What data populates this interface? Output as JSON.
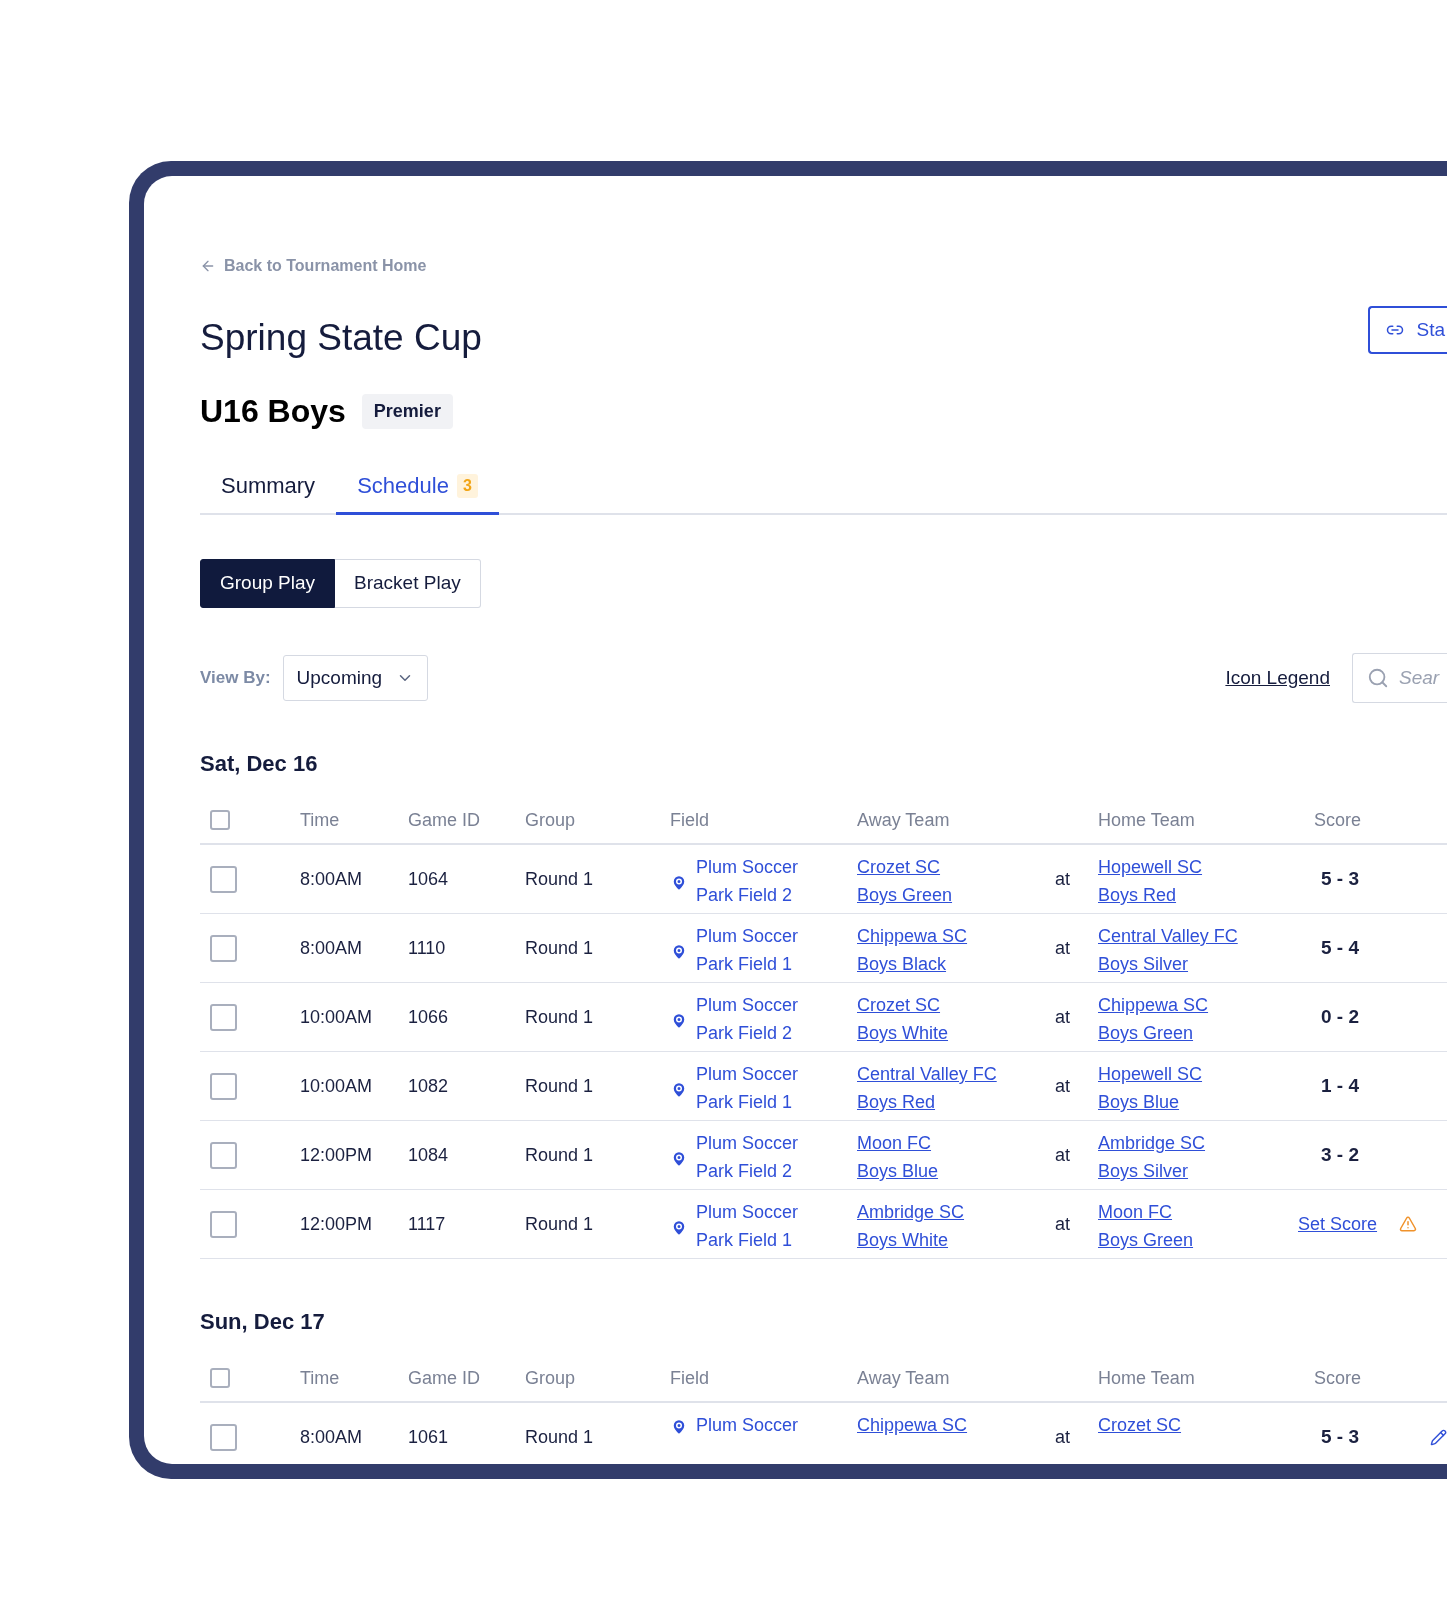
{
  "back_link": "Back to Tournament Home",
  "title": "Spring State Cup",
  "share_button": {
    "label": "Sta"
  },
  "division": {
    "name": "U16 Boys",
    "badge": "Premier"
  },
  "tabs": [
    {
      "label": "Summary",
      "selected": false
    },
    {
      "label": "Schedule",
      "selected": true,
      "badge": "3"
    }
  ],
  "play_toggle": [
    {
      "label": "Group Play",
      "selected": true
    },
    {
      "label": "Bracket Play",
      "selected": false
    }
  ],
  "view_by": {
    "label": "View By:",
    "value": "Upcoming"
  },
  "icon_legend": "Icon Legend",
  "search": {
    "placeholder": "Sear"
  },
  "days": [
    {
      "date": "Sat, Dec 16",
      "all_checked": false,
      "columns": [
        "Time",
        "Game ID",
        "Group",
        "Field",
        "Away Team",
        "Home Team",
        "Score"
      ],
      "rows": [
        {
          "checked": false,
          "time": "8:00AM",
          "game_id": "1064",
          "group": "Round 1",
          "field": [
            "Plum Soccer",
            "Park Field 2"
          ],
          "away": [
            "Crozet SC",
            "Boys Green"
          ],
          "at": "at",
          "home": [
            "Hopewell SC",
            "Boys Red"
          ],
          "score": {
            "kind": "result",
            "text": "5 - 3"
          }
        },
        {
          "checked": false,
          "time": "8:00AM",
          "game_id": "1110",
          "group": "Round 1",
          "field": [
            "Plum Soccer",
            "Park Field 1"
          ],
          "away": [
            "Chippewa SC",
            "Boys Black"
          ],
          "at": "at",
          "home": [
            "Central Valley FC",
            "Boys Silver"
          ],
          "score": {
            "kind": "result",
            "text": "5 - 4"
          }
        },
        {
          "checked": false,
          "time": "10:00AM",
          "game_id": "1066",
          "group": "Round 1",
          "field": [
            "Plum Soccer",
            "Park Field 2"
          ],
          "away": [
            "Crozet SC",
            "Boys White"
          ],
          "at": "at",
          "home": [
            "Chippewa SC",
            "Boys Green"
          ],
          "score": {
            "kind": "result",
            "text": "0 - 2"
          }
        },
        {
          "checked": false,
          "time": "10:00AM",
          "game_id": "1082",
          "group": "Round 1",
          "field": [
            "Plum Soccer",
            "Park Field 1"
          ],
          "away": [
            "Central Valley FC",
            "Boys Red"
          ],
          "at": "at",
          "home": [
            "Hopewell SC",
            "Boys Blue"
          ],
          "score": {
            "kind": "result",
            "text": "1 - 4"
          }
        },
        {
          "checked": false,
          "time": "12:00PM",
          "game_id": "1084",
          "group": "Round 1",
          "field": [
            "Plum Soccer",
            "Park Field 2"
          ],
          "away": [
            "Moon FC",
            "Boys Blue"
          ],
          "at": "at",
          "home": [
            "Ambridge SC",
            "Boys Silver"
          ],
          "score": {
            "kind": "result",
            "text": "3 - 2"
          }
        },
        {
          "checked": false,
          "time": "12:00PM",
          "game_id": "1117",
          "group": "Round 1",
          "field": [
            "Plum Soccer",
            "Park Field 1"
          ],
          "away": [
            "Ambridge SC",
            "Boys White"
          ],
          "at": "at",
          "home": [
            "Moon FC",
            "Boys Green"
          ],
          "score": {
            "kind": "set",
            "text": "Set Score"
          }
        }
      ]
    },
    {
      "date": "Sun, Dec 17",
      "all_checked": false,
      "columns": [
        "Time",
        "Game ID",
        "Group",
        "Field",
        "Away Team",
        "Home Team",
        "Score"
      ],
      "rows": [
        {
          "checked": false,
          "time": "8:00AM",
          "game_id": "1061",
          "group": "Round 1",
          "field": [
            "Plum Soccer"
          ],
          "away": [
            "Chippewa SC"
          ],
          "at": "at",
          "home": [
            "Crozet SC"
          ],
          "score": {
            "kind": "editable",
            "text": "5 - 3"
          }
        }
      ]
    }
  ]
}
